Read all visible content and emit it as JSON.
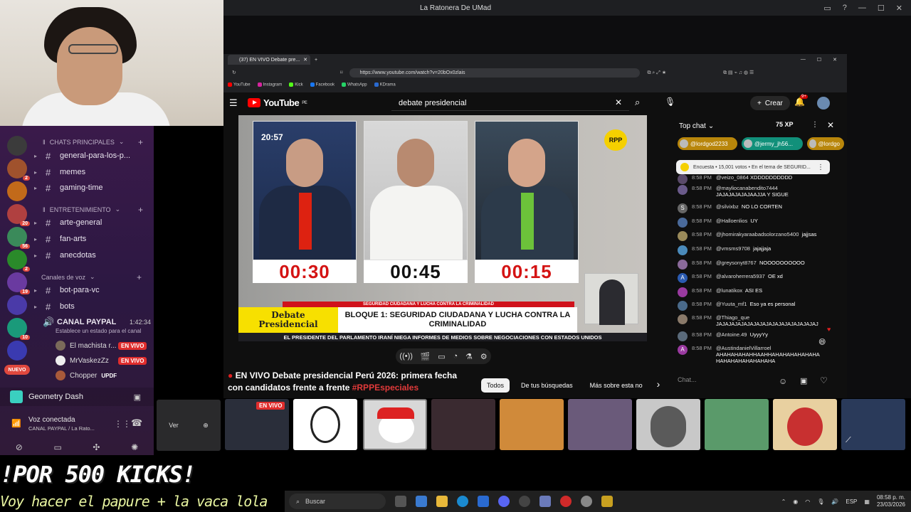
{
  "window": {
    "title": "La Ratonera De UMad"
  },
  "sidebar": {
    "categories": [
      "CHATS PRINCIPALES",
      "ENTRETENIMIENTO",
      "Canales de voz"
    ],
    "channels": [
      "general-para-los-p...",
      "memes",
      "gaming-time",
      "arte-general",
      "fan-arts",
      "anecdotas",
      "bot-para-vc",
      "bots"
    ],
    "server_badges": [
      "2",
      "20",
      "56",
      "2",
      "19",
      "10",
      "NUEVO"
    ],
    "voice_channel": {
      "name": "CANAL PAYPAL",
      "time": "1:42:34",
      "status": "Establece un estado para el canal"
    },
    "voice_users": [
      {
        "name": "El machista r...",
        "badge": "EN VIVO"
      },
      {
        "name": "MrVaskezZz",
        "badge": "EN VIVO"
      },
      {
        "name": "Chopper",
        "badge": "UPDF"
      }
    ],
    "activity": "Geometry Dash",
    "voice_status": {
      "title": "Voz conectada",
      "subtitle": "CANAL PAYPAL / La Rato..."
    }
  },
  "browser": {
    "tab_title": "(37) EN VIVO Debate pre...",
    "url": "https://www.youtube.com/watch?v=20bOx0zlais",
    "bookmarks": [
      "YouTube",
      "Instagram",
      "Kick",
      "Facebook",
      "WhatsApp",
      "KDrama"
    ]
  },
  "youtube": {
    "logo": "YouTube",
    "logo_region": "PE",
    "search_value": "debate presidencial",
    "create_label": "Crear",
    "notif_count": "9+",
    "video": {
      "clock": "20:57",
      "channel_logo": "RPP",
      "timers": [
        "00:30",
        "00:45",
        "00:15"
      ],
      "banner_strip": "SEGURIDAD CIUDADANA Y LUCHA CONTRA LA CRIMINALIDAD",
      "banner_left_1": "Debate",
      "banner_left_2": "Presidencial",
      "banner_main": "BLOQUE 1: SEGURIDAD CIUDADANA Y LUCHA CONTRA LA CRIMINALIDAD",
      "ticker": "EL PRESIDENTE DEL PARLAMENTO IRANÍ NIEGA INFORMES DE MEDIOS SOBRE NEGOCIACIONES CON ESTADOS UNIDOS"
    },
    "video_title_1": "EN VIVO Debate presidencial Perú 2026: primera fecha",
    "video_title_2": "con candidatos frente a frente",
    "video_title_tag": "#RPPEspeciales",
    "chips": [
      "Todos",
      "De tus búsquedas",
      "Más sobre esta no"
    ]
  },
  "chat": {
    "mode": "Top chat",
    "xp": "75 XP",
    "pinned": [
      "@lordgod2233",
      "@jermy_jh56...",
      "@lordgo"
    ],
    "poll": "Encuesta • 15,001 votos • En el tema de SEGURID...",
    "messages": [
      {
        "time": "8:58 PM",
        "author": "@veizo_0864",
        "text": "XDDDDDDDDDD"
      },
      {
        "time": "8:58 PM",
        "author": "@mayliocanabendito7444",
        "text": "JAJAJAJAJAJAAJJA Y SIGUE"
      },
      {
        "time": "8:58 PM",
        "author": "@silvixbz",
        "text": "NO LO CORTEN"
      },
      {
        "time": "8:58 PM",
        "author": "@Halloenlios",
        "text": "UY"
      },
      {
        "time": "8:58 PM",
        "author": "@jhomirakyaraabadsolorzano5400",
        "text": "jajjsas"
      },
      {
        "time": "8:58 PM",
        "author": "@vmsms9708",
        "text": "jajajjaja"
      },
      {
        "time": "8:58 PM",
        "author": "@greysonyt8767",
        "text": "NOOOOOOOOOO"
      },
      {
        "time": "8:58 PM",
        "author": "@alvaroherrera5937",
        "text": "OE xd"
      },
      {
        "time": "8:58 PM",
        "author": "@lunatikox",
        "text": "ASI ES"
      },
      {
        "time": "8:58 PM",
        "author": "@Yuuta_mf1",
        "text": "Eso ya es personal"
      },
      {
        "time": "8:58 PM",
        "author": "@Thiago_que",
        "text": "JAJAJAJAJAJAJAJAJAJAJAJAJAJAJAJAJ"
      },
      {
        "time": "8:58 PM",
        "author": "@Antoine.49",
        "text": "UyyyYy"
      },
      {
        "time": "8:58 PM",
        "author": "@AustindanielVillarroel",
        "text": "AHAHAHAHAHHAAHHAHAHAHAHAHAHAHAHAHAHAHAHAHAHA"
      }
    ],
    "input_placeholder": "Chat..."
  },
  "stream_bar": {
    "ver_label": "Ver",
    "live_label": "EN VIVO"
  },
  "overlay": {
    "kicks": "!POR 500 KICKS!",
    "papure": "Voy hacer el papure + la vaca lola"
  },
  "taskbar": {
    "search_label": "Buscar",
    "lang": "ESP",
    "time": "08:58 p. m.",
    "date": "23/03/2026"
  }
}
